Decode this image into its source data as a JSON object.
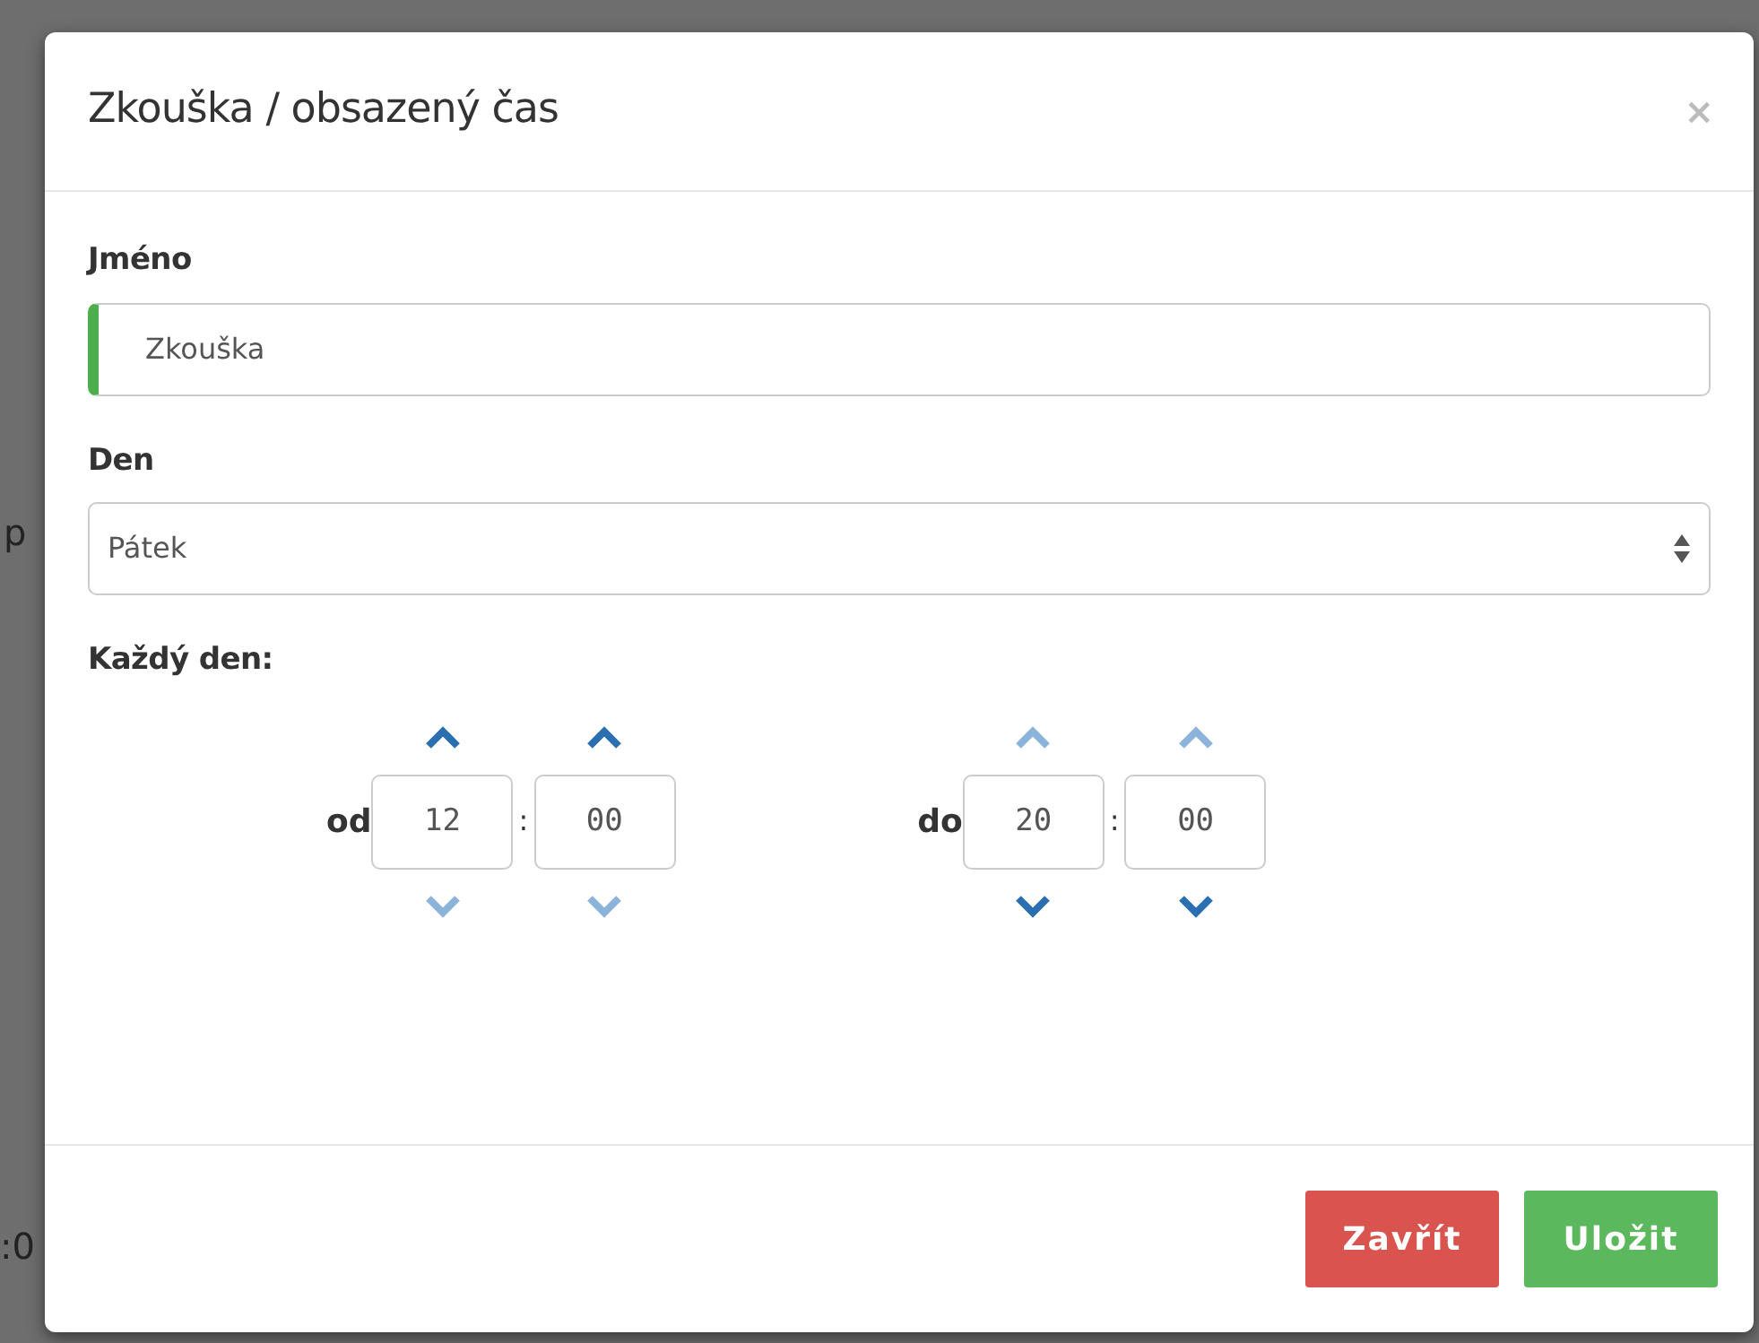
{
  "background_fragments": [
    "p",
    ":0"
  ],
  "dialog": {
    "title": "Zkouška / obsazený čas",
    "close": "×"
  },
  "name_field": {
    "label": "Jméno",
    "value": "Zkouška",
    "valid": true
  },
  "day_field": {
    "label": "Den",
    "value": "Pátek"
  },
  "every_day_label": "Každý den:",
  "time_ranges": [
    {
      "label": "od",
      "hours": {
        "value": "12",
        "up_enabled": true,
        "down_enabled": false
      },
      "separator": ":",
      "minutes": {
        "value": "00",
        "up_enabled": true,
        "down_enabled": false
      }
    },
    {
      "label": "do",
      "hours": {
        "value": "20",
        "up_enabled": false,
        "down_enabled": true
      },
      "separator": ":",
      "minutes": {
        "value": "00",
        "up_enabled": false,
        "down_enabled": true
      }
    }
  ],
  "buttons": [
    {
      "label": "Zavřít",
      "kind": "danger"
    },
    {
      "label": "Uložit",
      "kind": "success"
    }
  ]
}
